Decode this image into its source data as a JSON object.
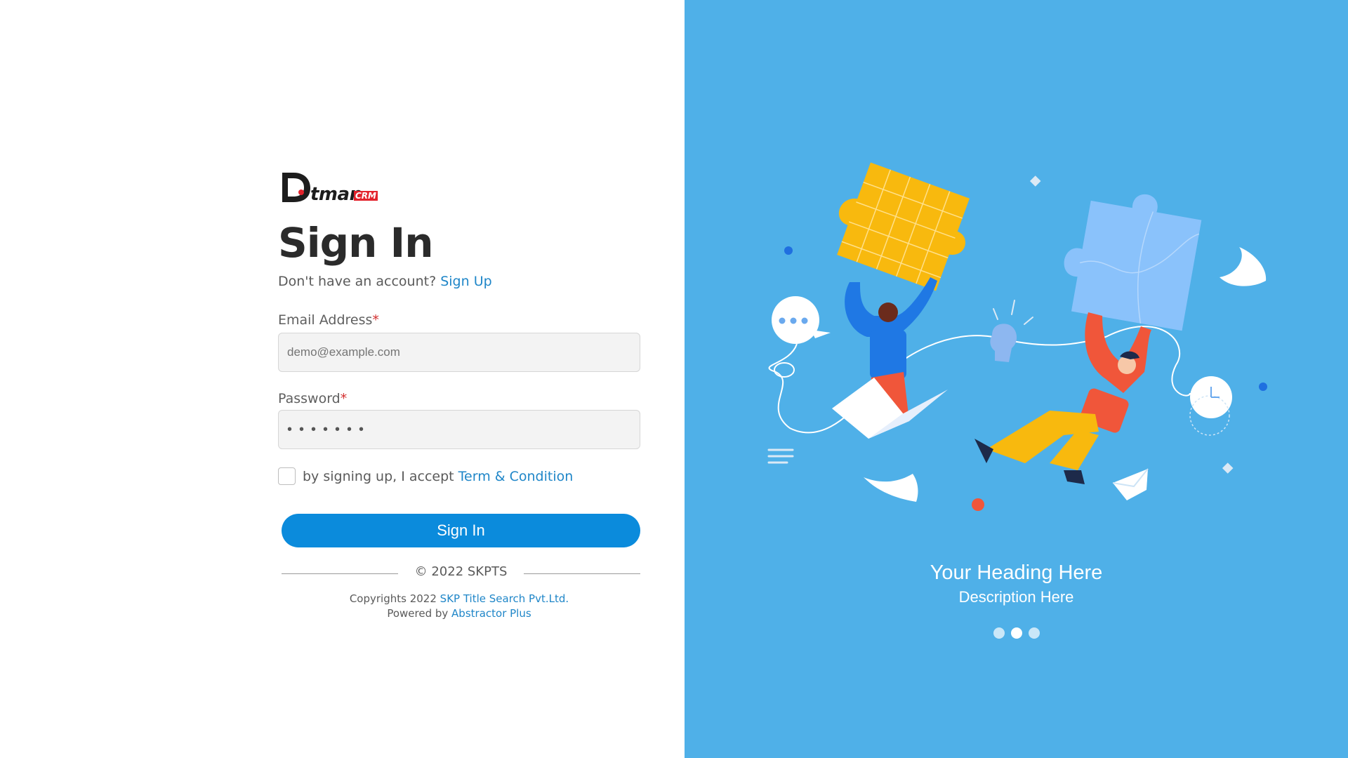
{
  "brand": {
    "logo_text": "tman",
    "logo_badge": "CRM"
  },
  "signin": {
    "title": "Sign In",
    "no_account_text": "Don't have an account?",
    "signup_link": "Sign Up",
    "email_label": "Email Address",
    "email_placeholder": "demo@example.com",
    "password_label": "Password",
    "password_value": "•••••••",
    "required_marker": "*",
    "terms_text": "by signing up, I accept",
    "terms_link": "Term & Condition",
    "submit_label": "Sign In",
    "divider_text": "© 2022 SKPTS"
  },
  "footer": {
    "copyright_prefix": "Copyrights 2022",
    "company_link": "SKP Title Search Pvt.Ltd.",
    "powered_prefix": "Powered by",
    "powered_link": "Abstractor Plus"
  },
  "hero": {
    "heading": "Your Heading Here",
    "description": "Description Here",
    "slides": 3,
    "active_slide": 2
  },
  "colors": {
    "panel_bg": "#4fb0e8",
    "button": "#0b8bdc",
    "link": "#1f86c8",
    "required": "#d32f2f"
  }
}
